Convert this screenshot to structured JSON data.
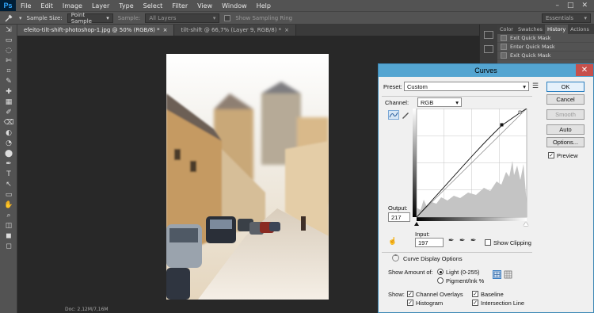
{
  "app": {
    "logo": "Ps"
  },
  "menu": [
    "File",
    "Edit",
    "Image",
    "Layer",
    "Type",
    "Select",
    "Filter",
    "View",
    "Window",
    "Help"
  ],
  "window_controls": {
    "minimize": "–",
    "maximize": "□",
    "close": "✕"
  },
  "options_bar": {
    "sample_size_label": "Sample Size:",
    "sample_size_value": "Point Sample",
    "sample_label": "Sample:",
    "sample_value": "All Layers",
    "show_ring_label": "Show Sampling Ring",
    "workspace": "Essentials"
  },
  "doc_tabs": [
    {
      "label": "efeito-tilt-shift-photoshop-1.jpg @ 50% (RGB/8) *",
      "close": "×"
    },
    {
      "label": "tilt-shift @ 66,7% (Layer 9, RGB/8) *",
      "close": "×"
    }
  ],
  "status_bar": {
    "text": "Doc: 2,12M/7,16M"
  },
  "right_panel": {
    "tabs": [
      "Color",
      "Swatches",
      "History",
      "Actions"
    ],
    "history_items": [
      "Exit Quick Mask",
      "Enter Quick Mask",
      "Exit Quick Mask"
    ]
  },
  "curves_dialog": {
    "title": "Curves",
    "close": "✕",
    "preset_label": "Preset:",
    "preset_value": "Custom",
    "channel_label": "Channel:",
    "channel_value": "RGB",
    "output_label": "Output:",
    "output_value": "217",
    "input_label": "Input:",
    "input_value": "197",
    "show_clipping_label": "Show Clipping",
    "display_options_label": "Curve Display Options",
    "show_amount_label": "Show Amount of:",
    "light_label": "Light  (0-255)",
    "pigment_label": "Pigment/Ink %",
    "show_label": "Show:",
    "channel_overlays_label": "Channel Overlays",
    "baseline_label": "Baseline",
    "histogram_label": "Histogram",
    "intersection_line_label": "Intersection Line",
    "buttons": {
      "ok": "OK",
      "cancel": "Cancel",
      "smooth": "Smooth",
      "auto": "Auto",
      "options": "Options..."
    },
    "preview_label": "Preview",
    "check_mark": "✓"
  },
  "icons": {
    "eyedropper": "eyedropper-icon",
    "dropdown": "chevron-down-icon",
    "curve_point": "curve-point-icon",
    "pencil": "pencil-icon",
    "tool_glyphs": [
      "⇲",
      "▭",
      "◌",
      "✄",
      "⌗",
      "✎",
      "✚",
      "▦",
      "✐",
      "⌫",
      "◐",
      "◔",
      "⬤",
      "✒",
      "T",
      "↖",
      "▭",
      "✋",
      "⌕",
      "◫",
      "◼",
      "◻"
    ]
  }
}
